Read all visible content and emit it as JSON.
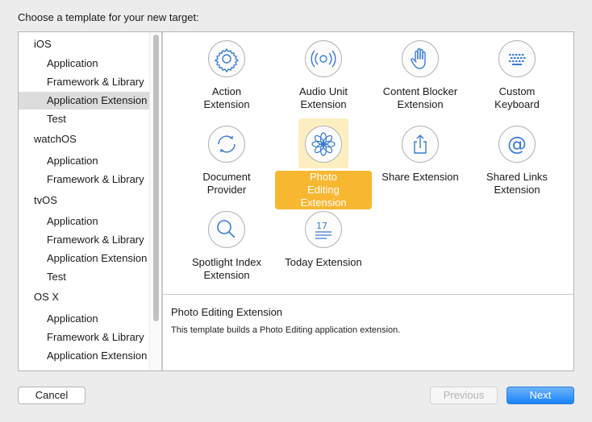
{
  "dialog": {
    "title": "Choose a template for your new target:"
  },
  "sidebar": {
    "items": [
      {
        "label": "iOS",
        "kind": "section"
      },
      {
        "label": "Application",
        "kind": "child"
      },
      {
        "label": "Framework & Library",
        "kind": "child"
      },
      {
        "label": "Application Extension",
        "kind": "child",
        "selected": true
      },
      {
        "label": "Test",
        "kind": "child"
      },
      {
        "label": "watchOS",
        "kind": "section"
      },
      {
        "label": "Application",
        "kind": "child"
      },
      {
        "label": "Framework & Library",
        "kind": "child"
      },
      {
        "label": "tvOS",
        "kind": "section"
      },
      {
        "label": "Application",
        "kind": "child"
      },
      {
        "label": "Framework & Library",
        "kind": "child"
      },
      {
        "label": "Application Extension",
        "kind": "child"
      },
      {
        "label": "Test",
        "kind": "child"
      },
      {
        "label": "OS X",
        "kind": "section"
      },
      {
        "label": "Application",
        "kind": "child"
      },
      {
        "label": "Framework & Library",
        "kind": "child"
      },
      {
        "label": "Application Extension",
        "kind": "child"
      }
    ]
  },
  "templates": [
    {
      "label_line1": "Action",
      "label_line2": "Extension",
      "icon": "gear-icon"
    },
    {
      "label_line1": "Audio Unit",
      "label_line2": "Extension",
      "icon": "audio-wave-icon"
    },
    {
      "label_line1": "Content Blocker",
      "label_line2": "Extension",
      "icon": "hand-icon"
    },
    {
      "label_line1": "Custom",
      "label_line2": "Keyboard",
      "icon": "keyboard-icon"
    },
    {
      "label_line1": "Document",
      "label_line2": "Provider",
      "icon": "sync-arrows-icon"
    },
    {
      "label_line1": "Photo Editing",
      "label_line2": "Extension",
      "icon": "flower-icon",
      "selected": true
    },
    {
      "label_line1": "Share Extension",
      "label_line2": "",
      "icon": "share-icon"
    },
    {
      "label_line1": "Shared Links",
      "label_line2": "Extension",
      "icon": "at-sign-icon"
    },
    {
      "label_line1": "Spotlight Index",
      "label_line2": "Extension",
      "icon": "magnifier-icon"
    },
    {
      "label_line1": "Today Extension",
      "label_line2": "",
      "icon": "calendar-list-icon",
      "icon_text": "17"
    }
  ],
  "description": {
    "title": "Photo Editing Extension",
    "body": "This template builds a Photo Editing application extension."
  },
  "buttons": {
    "cancel": "Cancel",
    "previous": "Previous",
    "next": "Next"
  },
  "colors": {
    "accent": "#1a82fb",
    "selection": "#f7b731",
    "selection_bg": "#fbeec0",
    "icon_blue": "#3a7bd5"
  }
}
